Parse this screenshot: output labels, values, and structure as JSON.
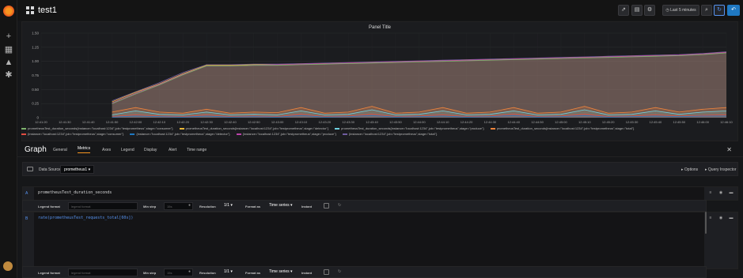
{
  "dashboard": {
    "title": "test1"
  },
  "toolbar": {
    "time_range": "Last 5 minutes",
    "share_icon": "share-icon",
    "save_icon": "save-icon",
    "settings_icon": "gear-icon",
    "zoom_icon": "zoom-out-icon",
    "refresh_icon": "refresh-icon",
    "back_icon": "back-icon"
  },
  "panel": {
    "title": "Panel Title"
  },
  "chart_data": {
    "type": "area",
    "title": "Panel Title",
    "x": [
      "12:41:20",
      "12:41:30",
      "12:41:40",
      "12:41:50",
      "12:42:00",
      "12:42:10",
      "12:42:20",
      "12:42:30",
      "12:42:40",
      "12:42:50",
      "12:43:00",
      "12:43:10",
      "12:43:20",
      "12:43:30",
      "12:43:40",
      "12:43:50",
      "12:44:00",
      "12:44:10",
      "12:44:20",
      "12:44:30",
      "12:44:40",
      "12:44:50",
      "12:45:00",
      "12:45:10",
      "12:45:20",
      "12:45:30",
      "12:45:40",
      "12:45:50",
      "12:46:00",
      "12:46:10"
    ],
    "ylim": [
      0,
      1.5
    ],
    "yticks": [
      "0",
      "0.25",
      "0.50",
      "0.75",
      "1.00",
      "1.25",
      "1.50"
    ],
    "grid": true,
    "legend_position": "bottom",
    "series": [
      {
        "name": "prometheusTest_duration_seconds{instance=\"localhost:1234\",job=\"testprometheus\",stage=\"consumer\"}",
        "color": "#7eb26d",
        "values": [
          null,
          null,
          null,
          0.25,
          0.42,
          0.58,
          0.76,
          0.92,
          0.92,
          0.93,
          0.93,
          0.94,
          0.95,
          0.96,
          0.97,
          0.98,
          0.99,
          1.0,
          1.01,
          1.02,
          1.03,
          1.04,
          1.05,
          1.06,
          1.07,
          1.08,
          1.09,
          1.1,
          1.12,
          1.15
        ]
      },
      {
        "name": "prometheusTest_duration_seconds{instance=\"localhost:1234\",job=\"testprometheus\",stage=\"detector\"}",
        "color": "#eab839",
        "values": [
          null,
          null,
          null,
          0.28,
          0.45,
          0.6,
          0.78,
          0.93,
          0.93,
          0.94,
          0.94,
          0.95,
          0.96,
          0.97,
          0.98,
          0.99,
          1.0,
          1.01,
          1.02,
          1.03,
          1.04,
          1.05,
          1.06,
          1.07,
          1.08,
          1.09,
          1.1,
          1.11,
          1.13,
          1.16
        ]
      },
      {
        "name": "prometheusTest_duration_seconds{instance=\"localhost:1234\",job=\"testprometheus\",stage=\"produce\"}",
        "color": "#6ed0e0",
        "values": [
          null,
          null,
          null,
          0.05,
          0.12,
          0.06,
          0.05,
          0.1,
          0.05,
          0.06,
          0.05,
          0.12,
          0.05,
          0.06,
          0.14,
          0.05,
          0.06,
          0.12,
          0.05,
          0.06,
          0.12,
          0.05,
          0.06,
          0.14,
          0.05,
          0.06,
          0.12,
          0.06,
          0.1,
          0.12
        ]
      },
      {
        "name": "prometheusTest_duration_seconds{instance=\"localhost:1234\",job=\"testprometheus\",stage=\"total\"}",
        "color": "#ef843c",
        "values": [
          null,
          null,
          null,
          0.1,
          0.18,
          0.1,
          0.08,
          0.15,
          0.08,
          0.1,
          0.09,
          0.18,
          0.08,
          0.1,
          0.2,
          0.08,
          0.1,
          0.18,
          0.08,
          0.1,
          0.18,
          0.08,
          0.1,
          0.2,
          0.08,
          0.1,
          0.18,
          0.1,
          0.15,
          0.18
        ]
      },
      {
        "name": "{instance=\"localhost:1234\",job=\"testprometheus\",stage=\"consumer\"}",
        "color": "#e24d42",
        "values": [
          null,
          null,
          null,
          0.02,
          0.05,
          0.03,
          0.02,
          0.05,
          0.02,
          0.03,
          0.02,
          0.06,
          0.02,
          0.03,
          0.06,
          0.02,
          0.03,
          0.05,
          0.02,
          0.03,
          0.06,
          0.02,
          0.03,
          0.06,
          0.02,
          0.03,
          0.05,
          0.03,
          0.04,
          0.05
        ]
      },
      {
        "name": "{instance=\"localhost:1234\",job=\"testprometheus\",stage=\"detector\"}",
        "color": "#1f78c1",
        "values": [
          null,
          null,
          null,
          0.01,
          0.03,
          0.02,
          0.01,
          0.03,
          0.01,
          0.02,
          0.01,
          0.04,
          0.01,
          0.02,
          0.04,
          0.01,
          0.02,
          0.03,
          0.01,
          0.02,
          0.04,
          0.01,
          0.02,
          0.04,
          0.01,
          0.02,
          0.03,
          0.02,
          0.03,
          0.03
        ]
      },
      {
        "name": "{instance=\"localhost:1234\",job=\"testprometheus\",stage=\"produce\"}",
        "color": "#ba43a9",
        "values": [
          null,
          null,
          null,
          0.26,
          0.43,
          0.59,
          0.77,
          0.92,
          0.92,
          0.93,
          0.94,
          0.95,
          0.96,
          0.97,
          0.98,
          0.99,
          1.0,
          1.01,
          1.02,
          1.03,
          1.04,
          1.05,
          1.06,
          1.07,
          1.08,
          1.09,
          1.1,
          1.11,
          1.13,
          1.16
        ]
      },
      {
        "name": "{instance=\"localhost:1234\",job=\"testprometheus\",stage=\"total\"}",
        "color": "#705da0",
        "values": [
          null,
          null,
          null,
          0.3,
          0.46,
          0.62,
          0.8,
          0.94,
          0.94,
          0.95,
          0.95,
          0.96,
          0.97,
          0.98,
          0.99,
          1.0,
          1.01,
          1.02,
          1.03,
          1.04,
          1.05,
          1.06,
          1.07,
          1.08,
          1.09,
          1.1,
          1.11,
          1.12,
          1.14,
          1.17
        ]
      }
    ]
  },
  "editor": {
    "title": "Graph",
    "tabs": [
      "General",
      "Metrics",
      "Axes",
      "Legend",
      "Display",
      "Alert",
      "Time range"
    ],
    "active_tab": "Metrics",
    "data_source_label": "Data Source",
    "data_source_value": "prometheus1",
    "options_label": "Options",
    "query_inspector_label": "Query Inspector"
  },
  "queries": [
    {
      "letter": "A",
      "expr": "prometheusTest_duration_seconds",
      "legend_label": "Legend format",
      "legend_placeholder": "legend format",
      "min_step_label": "Min step",
      "min_step_placeholder": "15s",
      "resolution_label": "Resolution",
      "resolution_value": "1/1",
      "format_label": "Format as",
      "format_value": "Time series",
      "instant_label": "Instant"
    },
    {
      "letter": "B",
      "expr": "rate(prometheusTest_requests_total[60s])",
      "legend_label": "Legend format",
      "legend_placeholder": "legend format",
      "min_step_label": "Min step",
      "min_step_placeholder": "15s",
      "resolution_label": "Resolution",
      "resolution_value": "1/1",
      "format_label": "Format as",
      "format_value": "Time series",
      "instant_label": "Instant"
    }
  ]
}
